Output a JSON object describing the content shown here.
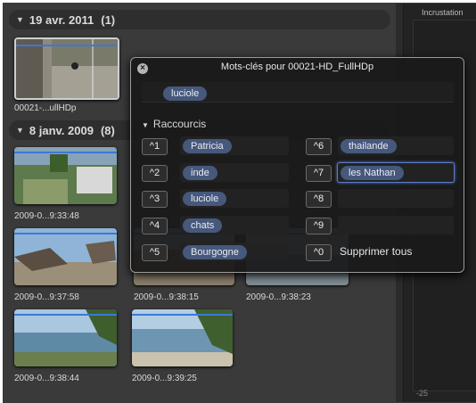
{
  "viewer": {
    "label": "Incrustation",
    "value": "-25"
  },
  "sections": [
    {
      "date": "19 avr. 2011",
      "count": "(1)"
    },
    {
      "date": "8 janv. 2009",
      "count": "(8)"
    }
  ],
  "clips": [
    {
      "caption": "00021-...ullHDp"
    },
    {
      "caption": "2009-0...9:33:48"
    },
    {
      "caption": "2009-0...9:37:58"
    },
    {
      "caption": "2009-0...9:38:15"
    },
    {
      "caption": "2009-0...9:38:23"
    },
    {
      "caption": "2009-0...9:38:44"
    },
    {
      "caption": "2009-0...9:39:25"
    }
  ],
  "hud": {
    "close_icon": "close-icon",
    "title": "Mots-clés pour 00021-HD_FullHDp",
    "current_keyword": "luciole",
    "shortcuts_label": "Raccourcis",
    "shortcuts_left": [
      {
        "key": "^1",
        "keyword": "Patricia"
      },
      {
        "key": "^2",
        "keyword": "inde"
      },
      {
        "key": "^3",
        "keyword": "luciole"
      },
      {
        "key": "^4",
        "keyword": "chats"
      },
      {
        "key": "^5",
        "keyword": "Bourgogne"
      }
    ],
    "shortcuts_right": [
      {
        "key": "^6",
        "keyword": "thailande"
      },
      {
        "key": "^7",
        "keyword": "les Nathan"
      },
      {
        "key": "^8",
        "keyword": ""
      },
      {
        "key": "^9",
        "keyword": ""
      },
      {
        "key": "^0",
        "keyword": ""
      }
    ],
    "delete_all_label": "Supprimer tous"
  },
  "colors": {
    "accent": "#3c78d8",
    "token": "#46587c"
  }
}
